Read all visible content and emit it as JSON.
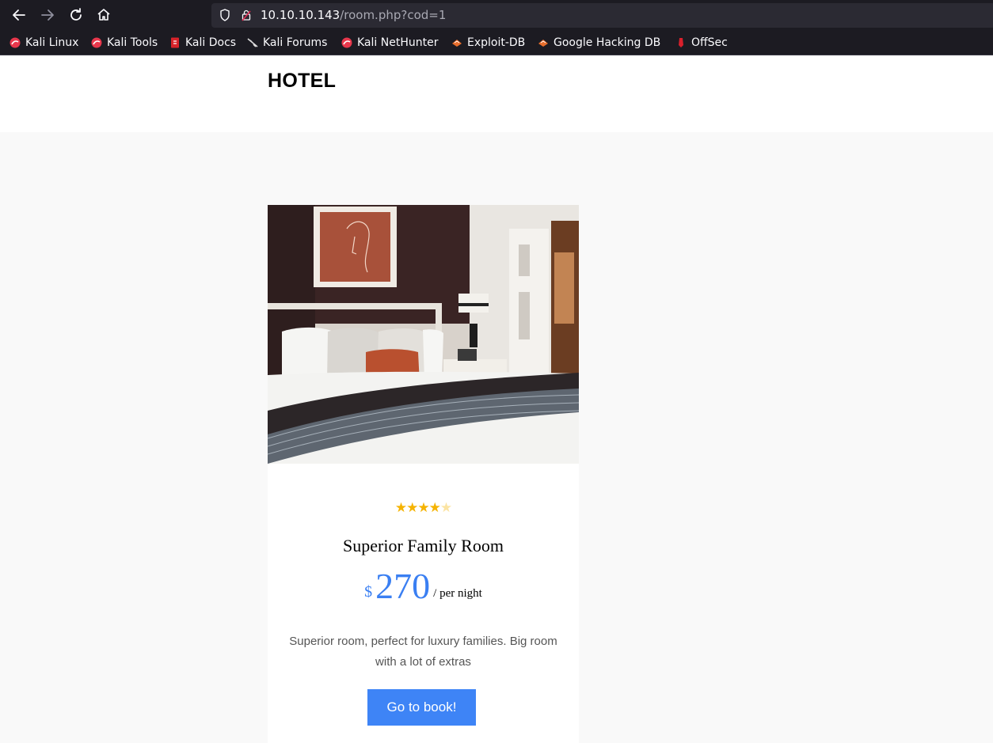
{
  "browser": {
    "url_host": "10.10.10.143",
    "url_path": "/room.php?cod=1",
    "bookmarks": [
      {
        "label": "Kali Linux",
        "icon": "kali-dragon-icon"
      },
      {
        "label": "Kali Tools",
        "icon": "kali-dragon-icon"
      },
      {
        "label": "Kali Docs",
        "icon": "kali-docs-icon"
      },
      {
        "label": "Kali Forums",
        "icon": "kali-forums-icon"
      },
      {
        "label": "Kali NetHunter",
        "icon": "kali-dragon-icon"
      },
      {
        "label": "Exploit-DB",
        "icon": "exploit-db-icon"
      },
      {
        "label": "Google Hacking DB",
        "icon": "exploit-db-icon"
      },
      {
        "label": "OffSec",
        "icon": "offsec-icon"
      }
    ]
  },
  "site": {
    "brand": "HOTEL"
  },
  "room": {
    "rating": 4,
    "rating_max": 5,
    "title": "Superior Family Room",
    "currency": "$",
    "price": "270",
    "per_night": "/ per night",
    "description": "Superior room, perfect for luxury families. Big room with a lot of extras",
    "book_label": "Go to book!"
  },
  "colors": {
    "accent": "#3e84f6",
    "star": "#f5b301",
    "chrome": "#1c1b22"
  }
}
